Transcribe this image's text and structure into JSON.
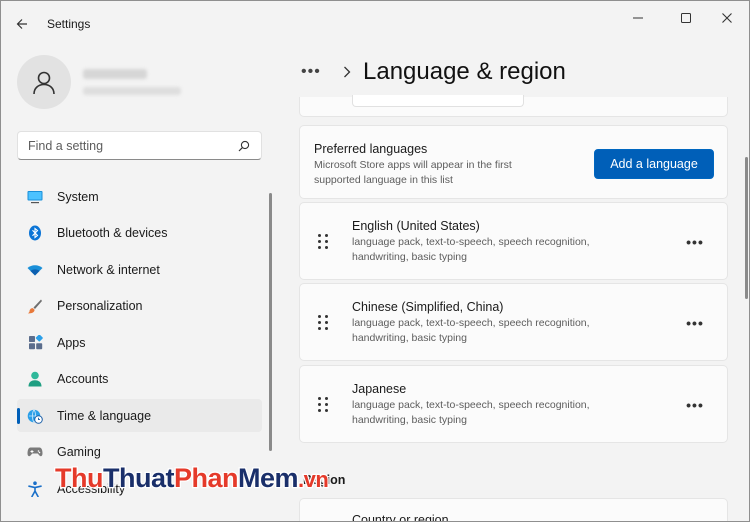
{
  "window": {
    "title": "Settings",
    "controls": {
      "minimize_icon": "minimize-icon",
      "maximize_icon": "maximize-icon",
      "close_icon": "close-icon"
    }
  },
  "sidebar": {
    "search": {
      "placeholder": "Find a setting",
      "value": ""
    },
    "items": [
      {
        "label": "System",
        "icon": "system-icon",
        "selected": false
      },
      {
        "label": "Bluetooth & devices",
        "icon": "bluetooth-icon",
        "selected": false
      },
      {
        "label": "Network & internet",
        "icon": "wifi-icon",
        "selected": false
      },
      {
        "label": "Personalization",
        "icon": "brush-icon",
        "selected": false
      },
      {
        "label": "Apps",
        "icon": "apps-icon",
        "selected": false
      },
      {
        "label": "Accounts",
        "icon": "accounts-icon",
        "selected": false
      },
      {
        "label": "Time & language",
        "icon": "globe-clock-icon",
        "selected": true
      },
      {
        "label": "Gaming",
        "icon": "gamepad-icon",
        "selected": false
      },
      {
        "label": "Accessibility",
        "icon": "accessibility-icon",
        "selected": false
      }
    ]
  },
  "main": {
    "breadcrumb_more": "•••",
    "title": "Language & region",
    "preferred": {
      "title": "Preferred languages",
      "description": "Microsoft Store apps will appear in the first supported language in this list",
      "add_button": "Add a language"
    },
    "languages": [
      {
        "name": "English (United States)",
        "features": "language pack, text-to-speech, speech recognition, handwriting, basic typing"
      },
      {
        "name": "Chinese (Simplified, China)",
        "features": "language pack, text-to-speech, speech recognition, handwriting, basic typing"
      },
      {
        "name": "Japanese",
        "features": "language pack, text-to-speech, speech recognition, handwriting, basic typing"
      }
    ],
    "more_label": "•••",
    "region_heading": "Region",
    "country_label": "Country or region"
  },
  "watermark": {
    "part1": "Thu",
    "part2": "Thuat",
    "part3": "Phan",
    "part4": "Mem",
    "part5": ".vn"
  },
  "colors": {
    "accent": "#005fb8",
    "background": "#f3f3f3",
    "card": "#fbfbfb"
  }
}
